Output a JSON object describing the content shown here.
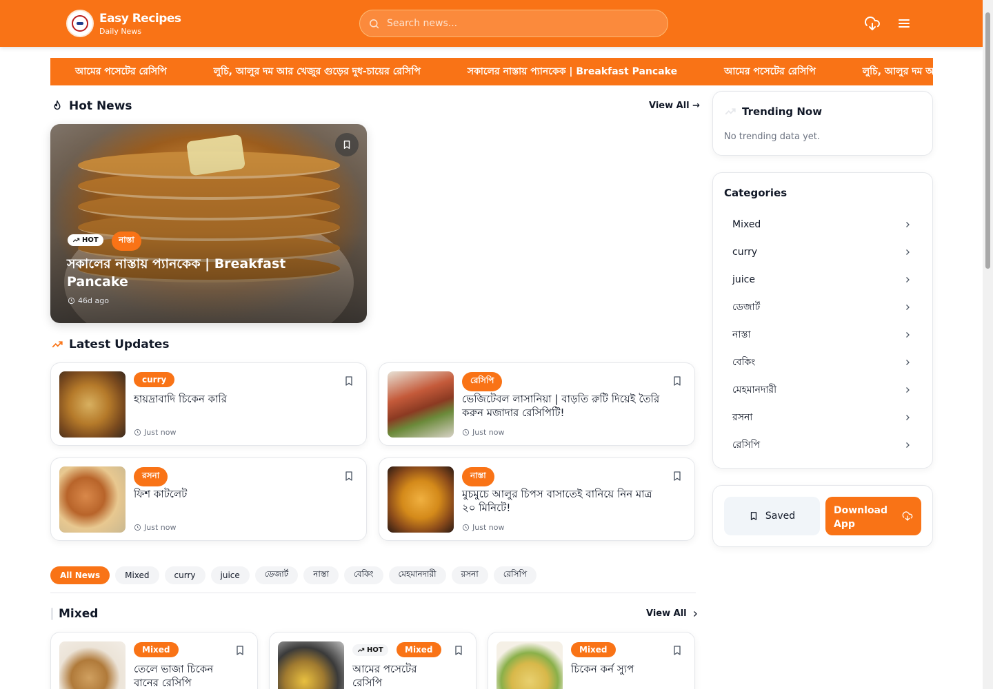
{
  "header": {
    "brand_title": "Easy Recipes",
    "brand_sub": "Daily News",
    "search_placeholder": "Search news..."
  },
  "ticker": [
    "আমের পসেটের রেসিপি",
    "লুচি, আলুর দম আর খেজুর গুড়ের দুধ-চায়ের রেসিপি",
    "সকালের নাস্তায় প্যানকেক | Breakfast Pancake",
    "আমের পসেটের রেসিপি",
    "লুচি, আলুর দম আর"
  ],
  "hot_news": {
    "title": "Hot News",
    "view_all": "View All →",
    "hot_badge": "HOT",
    "category": "নাস্তা",
    "headline": "সকালের নাস্তায় প্যানকেক | Breakfast Pancake",
    "time": "46d ago"
  },
  "latest": {
    "title": "Latest Updates",
    "cards": [
      {
        "category": "curry",
        "title": "হায়দ্রাবাদি চিকেন কারি",
        "time": "Just now"
      },
      {
        "category": "রেসিপি",
        "title": "ভেজিটেবল লাসানিয়া | বাড়তি রুটি দিয়েই তৈরি করুন মজাদার রেসিপিটি!",
        "time": "Just now"
      },
      {
        "category": "রসনা",
        "title": "ফিশ কাটলেট",
        "time": "Just now"
      },
      {
        "category": "নাস্তা",
        "title": "মুচমুচে আলুর চিপস বাসাতেই বানিয়ে নিন মাত্র ২০ মিনিটে!",
        "time": "Just now"
      }
    ]
  },
  "filters": [
    "All News",
    "Mixed",
    "curry",
    "juice",
    "ডেজার্ট",
    "নাস্তা",
    "বেকিং",
    "মেহমানদারী",
    "রসনা",
    "রেসিপি"
  ],
  "mixed": {
    "title": "Mixed",
    "view_all": "View All",
    "cards": [
      {
        "category": "Mixed",
        "title": "তেলে ভাজা চিকেন বানের রেসিপি",
        "hot": ""
      },
      {
        "category": "Mixed",
        "title": "আমের পসেটের রেসিপি",
        "hot": "HOT"
      },
      {
        "category": "Mixed",
        "title": "চিকেন কর্ন স্যুপ",
        "hot": ""
      }
    ]
  },
  "sidebar": {
    "trending_title": "Trending Now",
    "trending_empty": "No trending data yet.",
    "categories_title": "Categories",
    "categories": [
      "Mixed",
      "curry",
      "juice",
      "ডেজার্ট",
      "নাস্তা",
      "বেকিং",
      "মেহমানদারী",
      "রসনা",
      "রেসিপি"
    ],
    "saved_label": "Saved",
    "download_label": "Download App"
  },
  "colors": {
    "accent": "#f97316"
  }
}
